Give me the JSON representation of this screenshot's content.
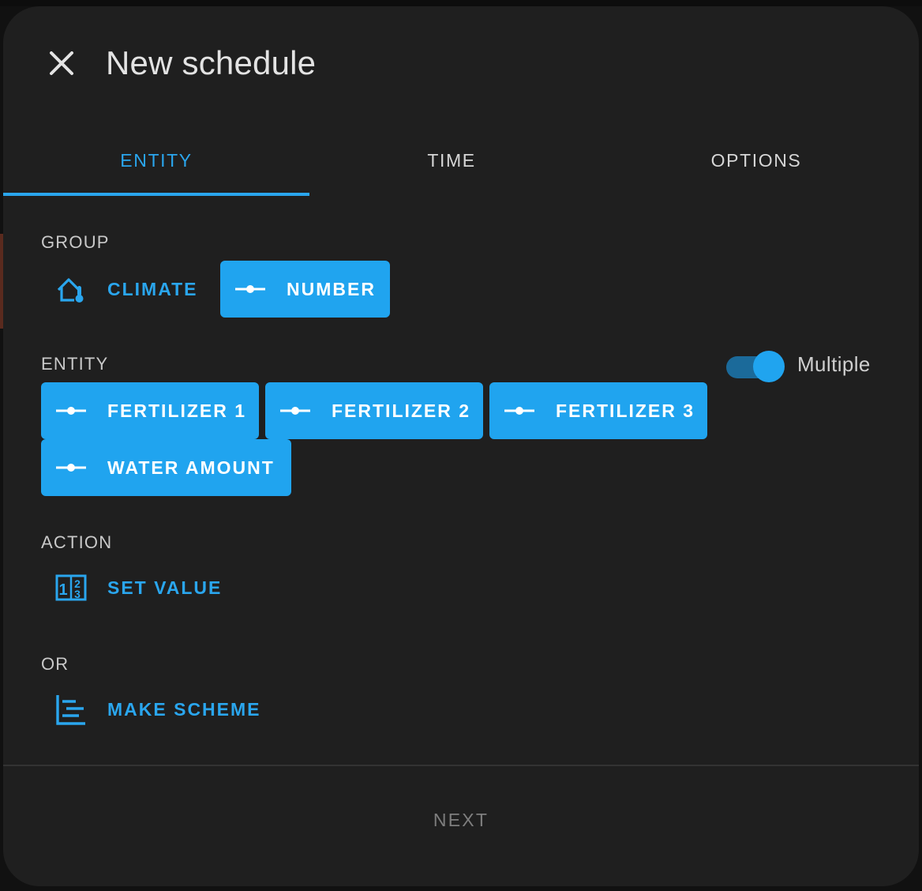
{
  "dialog": {
    "title": "New schedule"
  },
  "tabs": [
    {
      "label": "ENTITY",
      "active": true
    },
    {
      "label": "TIME",
      "active": false
    },
    {
      "label": "OPTIONS",
      "active": false
    }
  ],
  "group": {
    "label": "GROUP",
    "options": [
      {
        "label": "CLIMATE",
        "icon": "home-thermometer-icon",
        "selected": false
      },
      {
        "label": "NUMBER",
        "icon": "ray-vertex-icon",
        "selected": true
      }
    ]
  },
  "entity": {
    "label": "ENTITY",
    "multiple_label": "Multiple",
    "multiple_enabled": true,
    "options": [
      {
        "label": "FERTILIZER 1",
        "icon": "ray-vertex-icon",
        "selected": true
      },
      {
        "label": "FERTILIZER 2",
        "icon": "ray-vertex-icon",
        "selected": true
      },
      {
        "label": "FERTILIZER 3",
        "icon": "ray-vertex-icon",
        "selected": true
      },
      {
        "label": "WATER AMOUNT",
        "icon": "ray-vertex-icon",
        "selected": true
      }
    ]
  },
  "action": {
    "label": "ACTION",
    "options": [
      {
        "label": "SET VALUE",
        "icon": "numeric-icon"
      }
    ]
  },
  "or": {
    "label": "OR",
    "options": [
      {
        "label": "MAKE SCHEME",
        "icon": "chart-gantt-icon"
      }
    ]
  },
  "footer": {
    "next_label": "NEXT"
  },
  "colors": {
    "accent": "#20a4ef",
    "surface": "#1f1f1f",
    "text": "#e3e3e3"
  }
}
